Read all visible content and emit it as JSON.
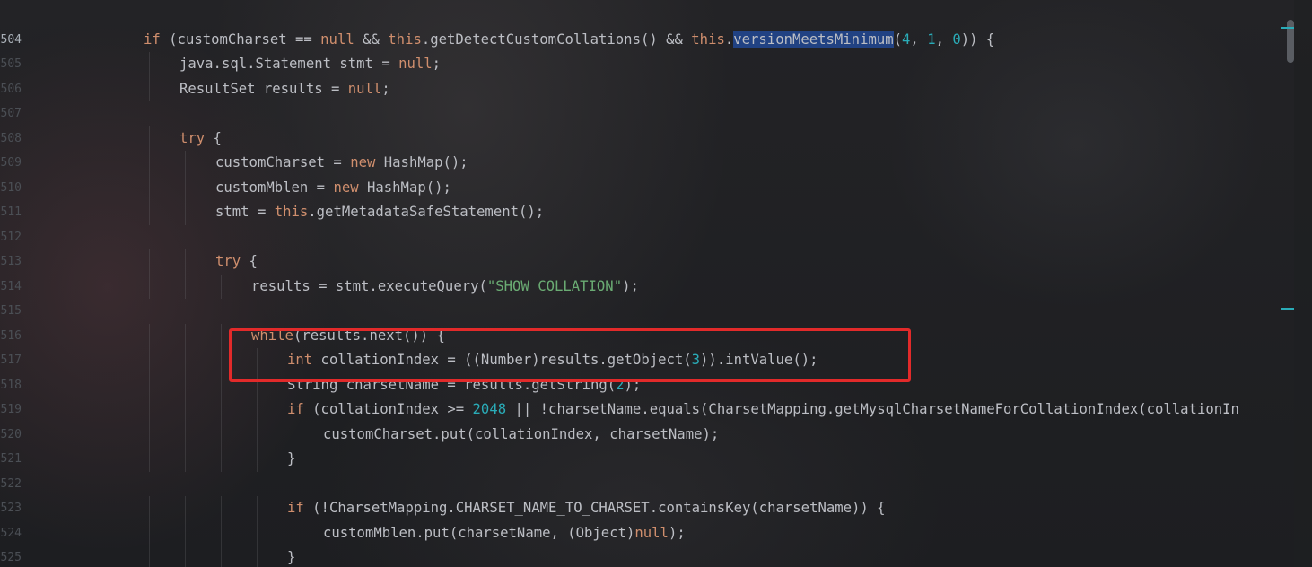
{
  "editor": {
    "line_numbers": [
      "504",
      "505",
      "506",
      "507",
      "508",
      "509",
      "510",
      "511",
      "512",
      "513",
      "514",
      "515",
      "516",
      "517",
      "518",
      "519",
      "520",
      "521",
      "522",
      "523",
      "524",
      "525"
    ],
    "current_line": "504",
    "lines": [
      {
        "indent": 0,
        "tokens": [
          [
            "kw",
            "if"
          ],
          [
            "t",
            " (customCharset == "
          ],
          [
            "kw",
            "null"
          ],
          [
            "t",
            " && "
          ],
          [
            "kw",
            "this"
          ],
          [
            "t",
            ".getDetectCustomCollations() && "
          ],
          [
            "kw",
            "this"
          ],
          [
            "t",
            "."
          ],
          [
            "sel",
            "versionMeetsMinimum"
          ],
          [
            "t",
            "("
          ],
          [
            "num",
            "4"
          ],
          [
            "t",
            ", "
          ],
          [
            "num",
            "1"
          ],
          [
            "t",
            ", "
          ],
          [
            "num",
            "0"
          ],
          [
            "t",
            ")) {"
          ]
        ]
      },
      {
        "indent": 1,
        "tokens": [
          [
            "t",
            "java.sql.Statement stmt = "
          ],
          [
            "kw",
            "null"
          ],
          [
            "t",
            ";"
          ]
        ]
      },
      {
        "indent": 1,
        "tokens": [
          [
            "t",
            "ResultSet results = "
          ],
          [
            "kw",
            "null"
          ],
          [
            "t",
            ";"
          ]
        ]
      },
      {
        "indent": 0,
        "tokens": []
      },
      {
        "indent": 1,
        "tokens": [
          [
            "kw",
            "try"
          ],
          [
            "t",
            " {"
          ]
        ]
      },
      {
        "indent": 2,
        "tokens": [
          [
            "t",
            "customCharset = "
          ],
          [
            "kw",
            "new"
          ],
          [
            "t",
            " HashMap();"
          ]
        ]
      },
      {
        "indent": 2,
        "tokens": [
          [
            "t",
            "customMblen = "
          ],
          [
            "kw",
            "new"
          ],
          [
            "t",
            " HashMap();"
          ]
        ]
      },
      {
        "indent": 2,
        "tokens": [
          [
            "t",
            "stmt = "
          ],
          [
            "kw",
            "this"
          ],
          [
            "t",
            ".getMetadataSafeStatement();"
          ]
        ]
      },
      {
        "indent": 0,
        "tokens": []
      },
      {
        "indent": 2,
        "tokens": [
          [
            "kw",
            "try"
          ],
          [
            "t",
            " {"
          ]
        ]
      },
      {
        "indent": 3,
        "tokens": [
          [
            "t",
            "results = stmt.executeQuery("
          ],
          [
            "str",
            "\"SHOW COLLATION\""
          ],
          [
            "t",
            ");"
          ]
        ]
      },
      {
        "indent": 0,
        "tokens": []
      },
      {
        "indent": 3,
        "tokens": [
          [
            "kw",
            "while"
          ],
          [
            "t",
            "(results.next()) {"
          ]
        ]
      },
      {
        "indent": 4,
        "tokens": [
          [
            "kw",
            "int"
          ],
          [
            "t",
            " collationIndex = ((Number)results.getObject("
          ],
          [
            "num",
            "3"
          ],
          [
            "t",
            ")).intValue();"
          ]
        ]
      },
      {
        "indent": 4,
        "tokens": [
          [
            "t",
            "String charsetName = results.getString("
          ],
          [
            "num",
            "2"
          ],
          [
            "t",
            ");"
          ]
        ]
      },
      {
        "indent": 4,
        "tokens": [
          [
            "kw",
            "if"
          ],
          [
            "t",
            " (collationIndex >= "
          ],
          [
            "num",
            "2048"
          ],
          [
            "t",
            " || !charsetName.equals(CharsetMapping.getMysqlCharsetNameForCollationIndex(collationIn"
          ]
        ]
      },
      {
        "indent": 5,
        "tokens": [
          [
            "t",
            "customCharset.put(collationIndex, charsetName);"
          ]
        ]
      },
      {
        "indent": 4,
        "tokens": [
          [
            "t",
            "}"
          ]
        ]
      },
      {
        "indent": 0,
        "tokens": []
      },
      {
        "indent": 4,
        "tokens": [
          [
            "kw",
            "if"
          ],
          [
            "t",
            " (!CharsetMapping.CHARSET_NAME_TO_CHARSET.containsKey(charsetName)) {"
          ]
        ]
      },
      {
        "indent": 5,
        "tokens": [
          [
            "t",
            "customMblen.put(charsetName, (Object)"
          ],
          [
            "kw",
            "null"
          ],
          [
            "t",
            ");"
          ]
        ]
      },
      {
        "indent": 4,
        "tokens": [
          [
            "t",
            "}"
          ]
        ]
      }
    ]
  },
  "colors": {
    "keyword": "#cf8e6d",
    "number": "#2aacb8",
    "string": "#6aab73",
    "text": "#bcbec4",
    "selection": "#214283",
    "highlight_box": "#e22a2a"
  }
}
